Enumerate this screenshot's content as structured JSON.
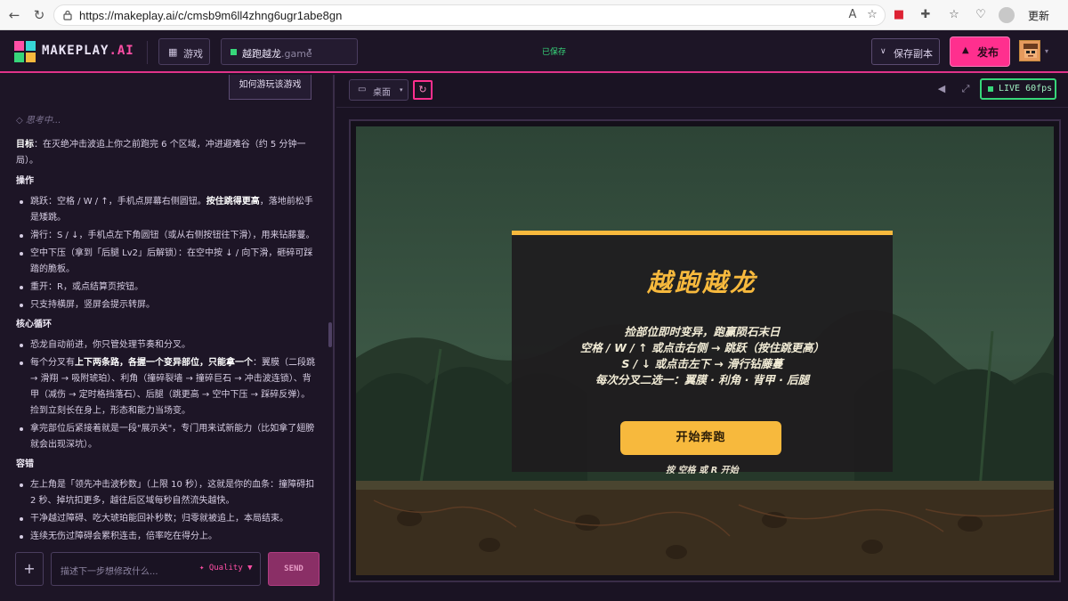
{
  "browser": {
    "url": "https://makeplay.ai/c/cmsb9m6ll4zhng6ugr1abe8gn",
    "update_label": "更新"
  },
  "header": {
    "logo_main": "MAKEPLAY",
    "logo_suffix": ".AI",
    "games_label": "游戏",
    "project_name": "越跑越龙",
    "project_ext": ".game",
    "saved_label": "已保存",
    "save_copy_label": "保存副本",
    "publish_label": "发布"
  },
  "left": {
    "howto_label": "如何游玩该游戏",
    "thinking": "思考中...",
    "goal_label": "目标",
    "goal_text": "：在灭绝冲击波追上你之前跑完 6 个区域，冲进避难谷（约 5 分钟一局）。",
    "controls_heading": "操作",
    "ctrl_jump_a": "跳跃：空格 / W / ↑，手机点屏幕右侧圆钮。",
    "ctrl_jump_b": "按住跳得更高",
    "ctrl_jump_c": "，落地前松手是矮跳。",
    "ctrl_slide": "滑行：S / ↓，手机点左下角圆钮（或从右侧按钮往下滑），用来钻藤蔓。",
    "ctrl_dive": "空中下压（拿到「后腿 Lv2」后解锁）：在空中按 ↓ / 向下滑，砸碎可踩踏的脆板。",
    "ctrl_restart": "重开：R，或点结算页按钮。",
    "ctrl_landscape": "只支持横屏，竖屏会提示转屏。",
    "loop_heading": "核心循环",
    "loop_auto": "恐龙自动前进，你只管处理节奏和分叉。",
    "loop_branch_a": "每个分叉有",
    "loop_branch_b": "上下两条路，各握一个变异部位，只能拿一个",
    "loop_branch_c": "：翼膜（二段跳 → 滑翔 → 吸附琥珀）、利角（撞碎裂墙 → 撞碎巨石 → 冲击波连锁）、背甲（减伤 → 定时格挡落石）、后腿（跳更高 → 空中下压 → 踩碎反弹）。捡到立刻长在身上，形态和能力当场变。",
    "loop_showcase": "拿完部位后紧接着就是一段\"展示关\"，专门用来试新能力（比如拿了翅膀就会出现深坑）。",
    "fault_heading": "容错",
    "fault_timer": "左上角是「领先冲击波秒数」（上限 10 秒），这就是你的血条：撞障碍扣 2 秒、掉坑扣更多，越往后区域每秒自然流失越快。",
    "fault_clean": "干净越过障碍、吃大琥珀能回补秒数；归零就被追上，本局结束。",
    "fault_combo": "连续无伤过障碍会累积连击，倍率吃在得分上。",
    "prompt_placeholder": "描述下一步想修改什么...",
    "quality_label": "✦ Quality ▼",
    "send_label": "SEND"
  },
  "right": {
    "view_label": "桌面",
    "live_label": "LIVE 60fps"
  },
  "game": {
    "title": "越跑越龙",
    "line1": "捡部位即时变异，跑赢陨石末日",
    "line2": "空格 / W / ↑ 或点击右侧 → 跳跃（按住跳更高）",
    "line3": "S / ↓ 或点击左下 → 滑行钻藤蔓",
    "line4": "每次分叉二选一：翼膜 · 利角 · 背甲 · 后腿",
    "start_label": "开始奔跑",
    "start_hint": "按 空格 或 R 开始"
  }
}
